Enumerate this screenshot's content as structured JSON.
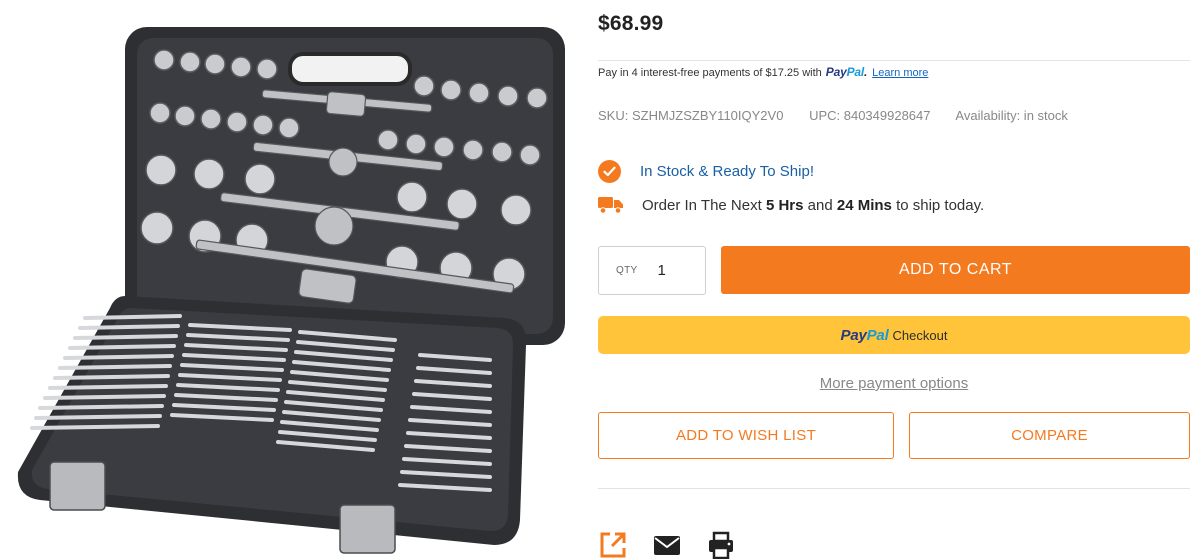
{
  "product": {
    "image_alt": "Tap and die set in black carrying case",
    "price": "$68.99",
    "paypal_installments": {
      "text": "Pay in 4 interest-free payments of $17.25 with",
      "brand_part1": "Pay",
      "brand_part2": "Pal",
      "learn_more": "Learn more"
    },
    "sku": "SKU: SZHMJZSZBY110IQY2V0",
    "upc": "UPC: 840349928647",
    "availability": "Availability: in stock",
    "stock_status": "In Stock & Ready To Ship!",
    "shipping": {
      "prefix": "Order In The Next",
      "hours": "5 Hrs",
      "and": "and",
      "mins": "24 Mins",
      "suffix": "to ship today."
    },
    "quantity": {
      "label": "QTY",
      "value": "1"
    },
    "buttons": {
      "add_to_cart": "ADD TO CART",
      "paypal_brand_part1": "Pay",
      "paypal_brand_part2": "Pal",
      "paypal_checkout": "Checkout",
      "more_payment_options": "More payment options",
      "add_to_wish_list": "ADD TO WISH LIST",
      "compare": "COMPARE"
    },
    "share_icons": [
      "share-external-icon",
      "email-icon",
      "print-icon"
    ]
  },
  "colors": {
    "accent": "#f47a20",
    "link": "#1565c0",
    "stock_text": "#1a5fa6",
    "paypal_button": "#ffc43a",
    "paypal_dark": "#253b80",
    "paypal_light": "#179bd7"
  }
}
